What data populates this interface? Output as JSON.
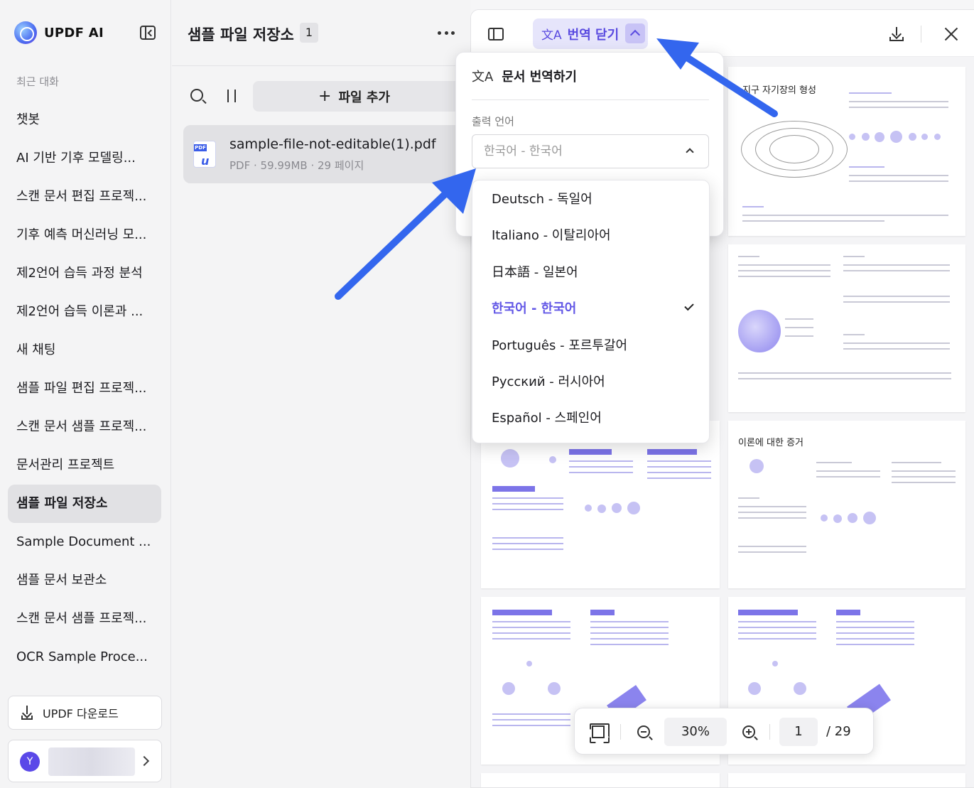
{
  "app": {
    "brand": "UPDF AI"
  },
  "sidebar": {
    "recent_label": "최근 대화",
    "chats": [
      {
        "label": "챗봇",
        "active": false
      },
      {
        "label": "AI 기반 기후 모델링...",
        "active": false
      },
      {
        "label": "스캔 문서 편집 프로젝...",
        "active": false
      },
      {
        "label": "기후 예측 머신러닝 모...",
        "active": false
      },
      {
        "label": "제2언어 습득 과정 분석",
        "active": false
      },
      {
        "label": "제2언어 습득 이론과 ...",
        "active": false
      },
      {
        "label": "새 채팅",
        "active": false
      },
      {
        "label": "샘플 파일 편집 프로젝...",
        "active": false
      },
      {
        "label": "스캔 문서 샘플 프로젝...",
        "active": false
      },
      {
        "label": "문서관리 프로젝트",
        "active": false
      },
      {
        "label": "샘플 파일 저장소",
        "active": true
      },
      {
        "label": "Sample Document ...",
        "active": false
      },
      {
        "label": "샘플 문서 보관소",
        "active": false
      },
      {
        "label": "스캔 문서 샘플 프로젝...",
        "active": false
      },
      {
        "label": "OCR Sample Proce...",
        "active": false
      }
    ],
    "download_label": "UPDF 다운로드",
    "user_initial": "Y"
  },
  "file_panel": {
    "title": "샘플 파일 저장소",
    "count": "1",
    "add_file_label": "파일 추가",
    "file": {
      "name": "sample-file-not-editable(1).pdf",
      "meta": "PDF · 59.99MB · 29 페이지",
      "badge": "PDF"
    }
  },
  "viewer": {
    "translate_button_label": "번역 닫기",
    "translate_icon": "文A",
    "thumb_titles": [
      "지구 자기장의 형성",
      "이론에 대한 증거"
    ]
  },
  "translation_popover": {
    "title": "문서 번역하기",
    "output_label": "출력 언어",
    "selected_value": "한국어 - 한국어"
  },
  "languages": [
    {
      "label": "Deutsch - 독일어",
      "selected": false
    },
    {
      "label": "Italiano - 이탈리아어",
      "selected": false
    },
    {
      "label": "日本語 - 일본어",
      "selected": false
    },
    {
      "label": "한국어 - 한국어",
      "selected": true
    },
    {
      "label": "Português - 포르투갈어",
      "selected": false
    },
    {
      "label": "Русский - 러시아어",
      "selected": false
    },
    {
      "label": "Español - 스페인어",
      "selected": false
    }
  ],
  "zoombar": {
    "zoom": "30%",
    "page": "1",
    "total": "/ 29"
  },
  "colors": {
    "accent": "#5a4be0",
    "arrow": "#3366ee",
    "selected_language": "#6257e6"
  }
}
